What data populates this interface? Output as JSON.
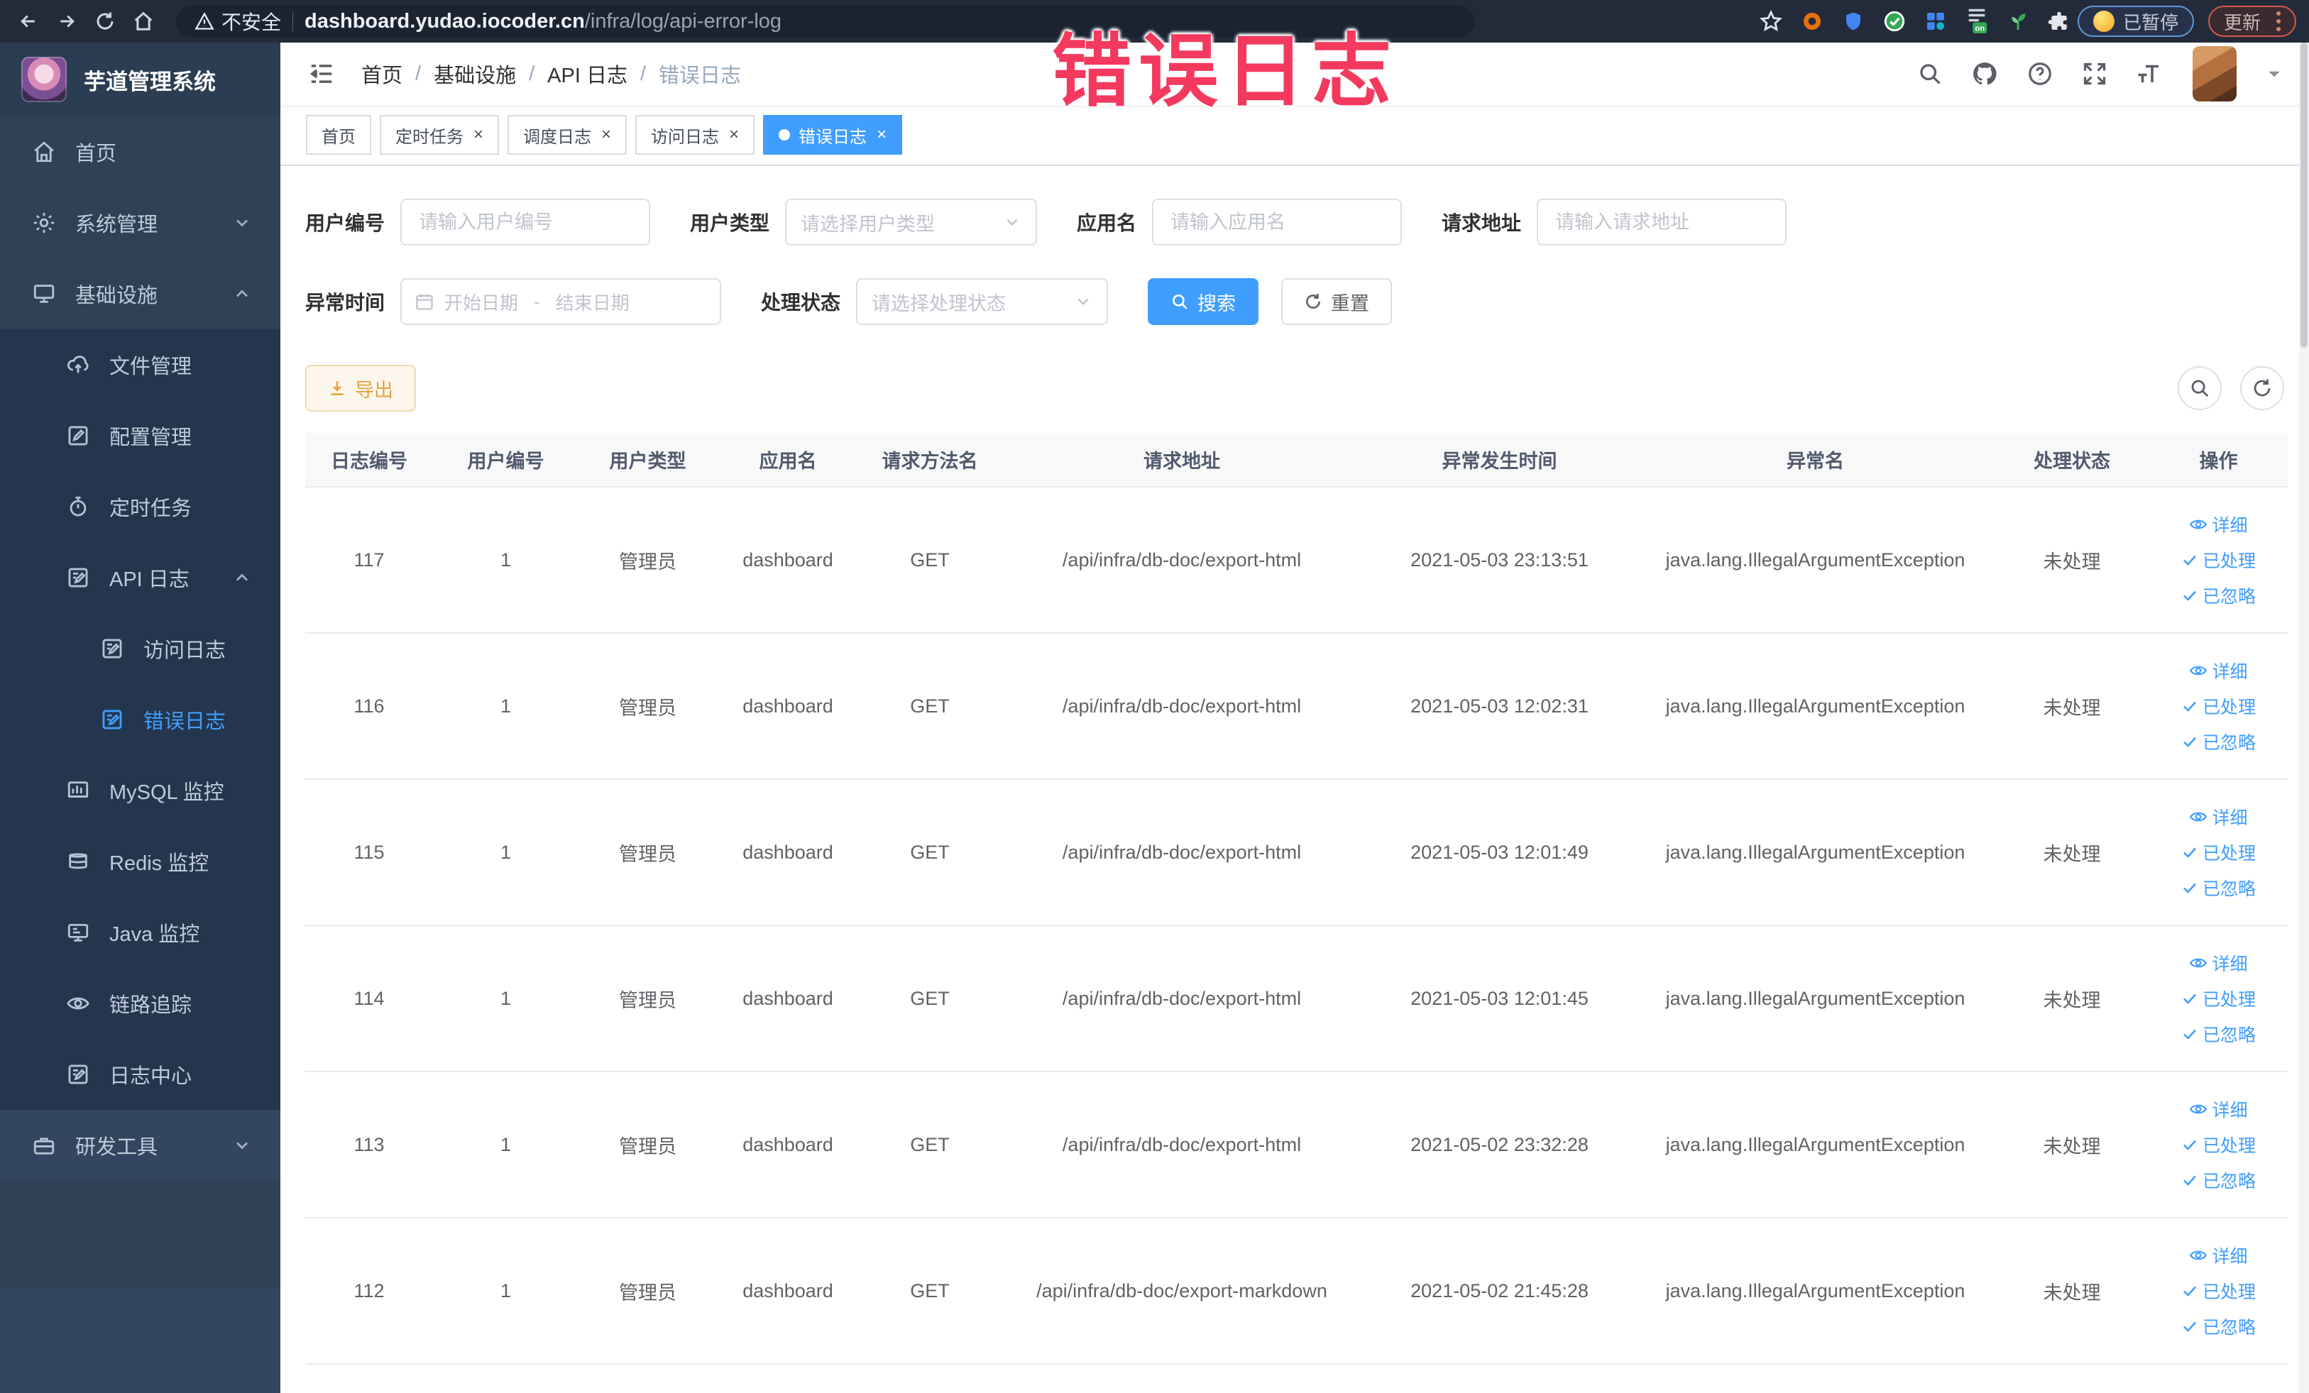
{
  "watermark": "错误日志",
  "browser": {
    "security_label": "不安全",
    "url_domain": "dashboard.yudao.iocoder.cn",
    "url_path": "/infra/log/api-error-log",
    "extensions": [
      {
        "name": "bookmark-star-icon",
        "bg": "transparent",
        "glyph": "star"
      },
      {
        "name": "orange-extension-icon",
        "bg": "#e8710a",
        "glyph": "ring"
      },
      {
        "name": "blue-shield-extension-icon",
        "bg": "transparent",
        "glyph": "shield"
      },
      {
        "name": "green-check-extension-icon",
        "bg": "#ffffff",
        "glyph": "greencheck"
      },
      {
        "name": "grid-extension-icon",
        "bg": "transparent",
        "glyph": "grid"
      },
      {
        "name": "on-badge-extension-icon",
        "bg": "transparent",
        "glyph": "onbadge",
        "badge": "on"
      },
      {
        "name": "green-sprout-extension-icon",
        "bg": "transparent",
        "glyph": "sprout"
      },
      {
        "name": "puzzle-extensions-icon",
        "bg": "transparent",
        "glyph": "puzzle"
      }
    ],
    "paused_badge": "已暂停",
    "update_badge": "更新"
  },
  "sidebar": {
    "logo_title": "芋道管理系统",
    "items": [
      {
        "id": "home",
        "icon": "home-icon",
        "label": "首页",
        "level": 0,
        "section": "top"
      },
      {
        "id": "system",
        "icon": "gear-icon",
        "label": "系统管理",
        "level": 0,
        "section": "top",
        "chevron": "down"
      },
      {
        "id": "infra",
        "icon": "monitor-icon",
        "label": "基础设施",
        "level": 0,
        "section": "top",
        "chevron": "up"
      },
      {
        "id": "file",
        "icon": "cloud-upload-icon",
        "label": "文件管理",
        "level": 1,
        "section": "dark"
      },
      {
        "id": "config",
        "icon": "edit-icon",
        "label": "配置管理",
        "level": 1,
        "section": "dark"
      },
      {
        "id": "job",
        "icon": "timer-icon",
        "label": "定时任务",
        "level": 1,
        "section": "dark"
      },
      {
        "id": "api-log",
        "icon": "log-edit-icon",
        "label": "API 日志",
        "level": 1,
        "section": "dark",
        "chevron": "up"
      },
      {
        "id": "access-log",
        "icon": "log-edit-icon",
        "label": "访问日志",
        "level": 2,
        "section": "dark"
      },
      {
        "id": "error-log",
        "icon": "log-edit-icon",
        "label": "错误日志",
        "level": 2,
        "section": "dark",
        "active": true
      },
      {
        "id": "mysql",
        "icon": "chart-icon",
        "label": "MySQL 监控",
        "level": 1,
        "section": "dark"
      },
      {
        "id": "redis",
        "icon": "stack-icon",
        "label": "Redis 监控",
        "level": 1,
        "section": "dark"
      },
      {
        "id": "java",
        "icon": "screen-icon",
        "label": "Java 监控",
        "level": 1,
        "section": "dark"
      },
      {
        "id": "trace",
        "icon": "eye-icon",
        "label": "链路追踪",
        "level": 1,
        "section": "dark"
      },
      {
        "id": "log-center",
        "icon": "log-edit-icon",
        "label": "日志中心",
        "level": 1,
        "section": "dark"
      },
      {
        "id": "dev-tools",
        "icon": "briefcase-icon",
        "label": "研发工具",
        "level": 0,
        "section": "light",
        "chevron": "down"
      }
    ]
  },
  "header": {
    "breadcrumb": [
      "首页",
      "基础设施",
      "API 日志",
      "错误日志"
    ]
  },
  "tabs": [
    {
      "id": "home",
      "label": "首页",
      "closable": false,
      "active": false
    },
    {
      "id": "job",
      "label": "定时任务",
      "closable": true,
      "active": false
    },
    {
      "id": "job-log",
      "label": "调度日志",
      "closable": true,
      "active": false
    },
    {
      "id": "api-access",
      "label": "访问日志",
      "closable": true,
      "active": false
    },
    {
      "id": "api-error",
      "label": "错误日志",
      "closable": true,
      "active": true
    }
  ],
  "filters": {
    "user_id": {
      "label": "用户编号",
      "placeholder": "请输入用户编号"
    },
    "user_type": {
      "label": "用户类型",
      "placeholder": "请选择用户类型"
    },
    "app_name": {
      "label": "应用名",
      "placeholder": "请输入应用名"
    },
    "request_url": {
      "label": "请求地址",
      "placeholder": "请输入请求地址"
    },
    "exception_time": {
      "label": "异常时间",
      "start_placeholder": "开始日期",
      "separator": "-",
      "end_placeholder": "结束日期"
    },
    "process_status": {
      "label": "处理状态",
      "placeholder": "请选择处理状态"
    },
    "search_label": "搜索",
    "reset_label": "重置"
  },
  "toolbar": {
    "export_label": "导出"
  },
  "table": {
    "columns": [
      "日志编号",
      "用户编号",
      "用户类型",
      "应用名",
      "请求方法名",
      "请求地址",
      "异常发生时间",
      "异常名",
      "处理状态",
      "操作"
    ],
    "actions": [
      "详细",
      "已处理",
      "已忽略"
    ],
    "rows": [
      {
        "log_id": "117",
        "user_id": "1",
        "user_type": "管理员",
        "app_name": "dashboard",
        "method": "GET",
        "url": "/api/infra/db-doc/export-html",
        "time": "2021-05-03 23:13:51",
        "exception": "java.lang.IllegalArgumentException",
        "status": "未处理"
      },
      {
        "log_id": "116",
        "user_id": "1",
        "user_type": "管理员",
        "app_name": "dashboard",
        "method": "GET",
        "url": "/api/infra/db-doc/export-html",
        "time": "2021-05-03 12:02:31",
        "exception": "java.lang.IllegalArgumentException",
        "status": "未处理"
      },
      {
        "log_id": "115",
        "user_id": "1",
        "user_type": "管理员",
        "app_name": "dashboard",
        "method": "GET",
        "url": "/api/infra/db-doc/export-html",
        "time": "2021-05-03 12:01:49",
        "exception": "java.lang.IllegalArgumentException",
        "status": "未处理"
      },
      {
        "log_id": "114",
        "user_id": "1",
        "user_type": "管理员",
        "app_name": "dashboard",
        "method": "GET",
        "url": "/api/infra/db-doc/export-html",
        "time": "2021-05-03 12:01:45",
        "exception": "java.lang.IllegalArgumentException",
        "status": "未处理"
      },
      {
        "log_id": "113",
        "user_id": "1",
        "user_type": "管理员",
        "app_name": "dashboard",
        "method": "GET",
        "url": "/api/infra/db-doc/export-html",
        "time": "2021-05-02 23:32:28",
        "exception": "java.lang.IllegalArgumentException",
        "status": "未处理"
      },
      {
        "log_id": "112",
        "user_id": "1",
        "user_type": "管理员",
        "app_name": "dashboard",
        "method": "GET",
        "url": "/api/infra/db-doc/export-markdown",
        "time": "2021-05-02 21:45:28",
        "exception": "java.lang.IllegalArgumentException",
        "status": "未处理"
      }
    ]
  },
  "colors": {
    "accent": "#409eff",
    "warning": "#e6a23c",
    "watermark": "#f4395e",
    "sidebar_bg": "#2e4156",
    "sidebar_submenu_bg": "#24364d"
  }
}
